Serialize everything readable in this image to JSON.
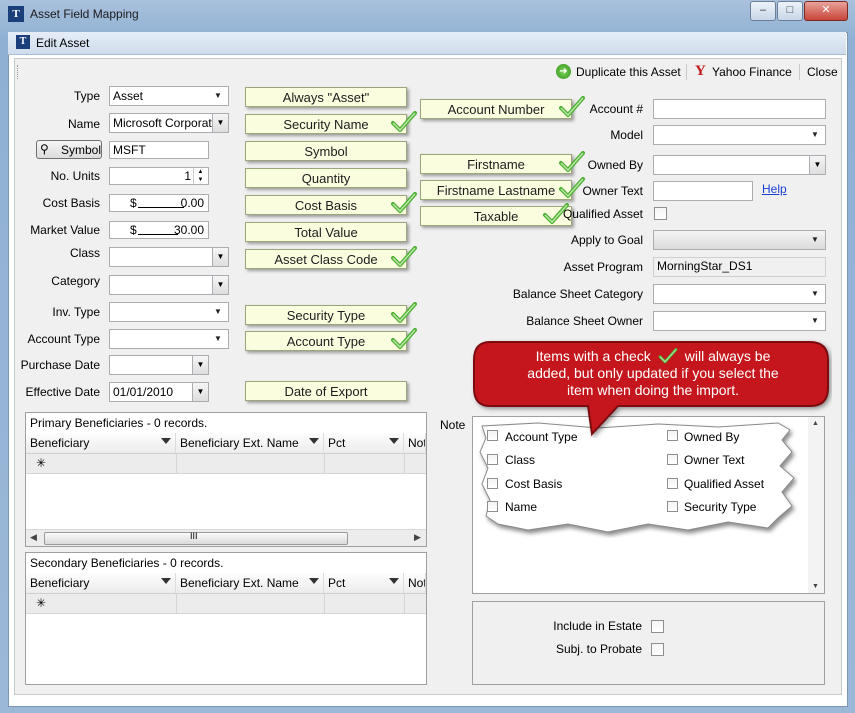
{
  "window": {
    "title": "Asset Field Mapping",
    "minimize": "–",
    "maximize": "□",
    "close": "✕"
  },
  "editor": {
    "title": "Edit Asset",
    "toolbar": {
      "duplicate": "Duplicate this Asset",
      "yahoo": "Yahoo Finance",
      "close": "Close"
    }
  },
  "left_fields": {
    "type": {
      "label": "Type",
      "value": "Asset"
    },
    "name": {
      "label": "Name",
      "value": "Microsoft Corporati"
    },
    "symbol": {
      "button": "Symbol",
      "value": "MSFT"
    },
    "units": {
      "label": "No. Units",
      "value": "1"
    },
    "cost_basis": {
      "label": "Cost Basis",
      "prefix": "$",
      "value": "0.00"
    },
    "market_value": {
      "label": "Market Value",
      "prefix": "$",
      "value": "30.00"
    },
    "class": {
      "label": "Class",
      "value": ""
    },
    "category": {
      "label": "Category",
      "value": ""
    },
    "inv_type": {
      "label": "Inv. Type",
      "value": ""
    },
    "account_type": {
      "label": "Account Type",
      "value": ""
    },
    "purchase_date": {
      "label": "Purchase Date",
      "value": ""
    },
    "effective_date": {
      "label": "Effective Date",
      "value": "01/01/2010"
    }
  },
  "mappings_left": [
    {
      "label": "Always \"Asset\"",
      "checked": false
    },
    {
      "label": "Security Name",
      "checked": true
    },
    {
      "label": "Symbol",
      "checked": false
    },
    {
      "label": "Quantity",
      "checked": false
    },
    {
      "label": "Cost Basis",
      "checked": true
    },
    {
      "label": "Total Value",
      "checked": false
    },
    {
      "label": "Asset Class Code",
      "checked": true
    },
    {
      "label": "Security Type",
      "checked": true
    },
    {
      "label": "Account Type",
      "checked": true
    },
    {
      "label": "Date of Export",
      "checked": false
    }
  ],
  "mappings_mid": [
    {
      "label": "Account Number",
      "checked": true
    },
    {
      "label": "Firstname",
      "checked": true
    },
    {
      "label": "Firstname Lastname",
      "checked": true
    },
    {
      "label": "Taxable",
      "checked": true
    }
  ],
  "right_fields": {
    "account_no": {
      "label": "Account #",
      "value": ""
    },
    "model": {
      "label": "Model",
      "value": ""
    },
    "owned_by": {
      "label": "Owned By",
      "value": ""
    },
    "owner_text": {
      "label": "Owner Text",
      "value": "",
      "help": "Help"
    },
    "qualified_asset": {
      "label": "Qualified Asset"
    },
    "apply_to_goal": {
      "label": "Apply to Goal",
      "value": ""
    },
    "asset_program": {
      "label": "Asset Program",
      "value": "MorningStar_DS1"
    },
    "balance_sheet_category": {
      "label": "Balance Sheet Category",
      "value": ""
    },
    "balance_sheet_owner": {
      "label": "Balance Sheet Owner",
      "value": ""
    }
  },
  "primary_beneficiaries": {
    "title": "Primary Beneficiaries - 0 records.",
    "columns": [
      "Beneficiary",
      "Beneficiary Ext. Name",
      "Pct",
      "Note"
    ],
    "new_row_marker": "✳",
    "scroll_mark": "III"
  },
  "secondary_beneficiaries": {
    "title": "Secondary Beneficiaries - 0 records.",
    "columns": [
      "Beneficiary",
      "Beneficiary Ext. Name",
      "Pct",
      "Note"
    ],
    "new_row_marker": "✳"
  },
  "note": {
    "label": "Note"
  },
  "callout": {
    "line1_before": "Items with a check",
    "line1_after": "will always be",
    "line2": "added, but only updated if you select the",
    "line3": "item when doing the import."
  },
  "update_options": [
    {
      "label": "Account Type"
    },
    {
      "label": "Owned By"
    },
    {
      "label": "Class"
    },
    {
      "label": "Owner Text"
    },
    {
      "label": "Cost Basis"
    },
    {
      "label": "Qualified Asset"
    },
    {
      "label": "Name"
    },
    {
      "label": "Security Type"
    }
  ],
  "estate": {
    "include_in_estate": "Include in Estate",
    "subj_to_probate": "Subj. to Probate"
  },
  "colors": {
    "callout_bg": "#fafdde",
    "check_green": "#4caf32",
    "bubble_red": "#c4161c",
    "link_blue": "#1a3fd1"
  }
}
